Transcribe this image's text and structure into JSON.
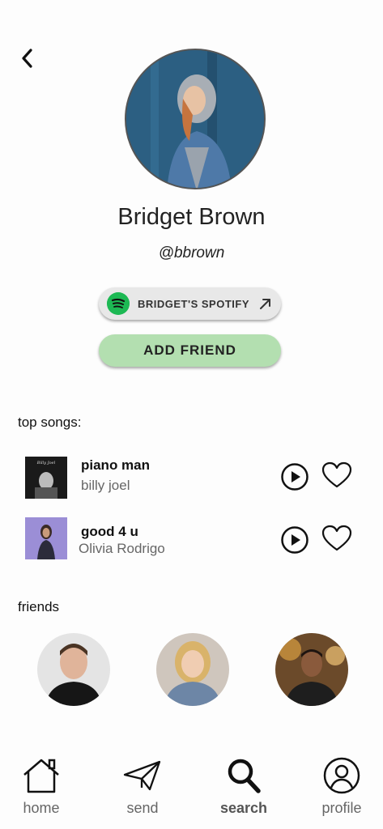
{
  "profile": {
    "name": "Bridget Brown",
    "handle": "@bbrown",
    "spotify_label": "BRIDGET'S SPOTIFY",
    "add_friend_label": "ADD FRIEND"
  },
  "top_songs": {
    "title": "top songs:",
    "items": [
      {
        "title": "piano man",
        "artist": "billy joel"
      },
      {
        "title": "good 4 u",
        "artist": "Olivia Rodrigo"
      }
    ]
  },
  "friends": {
    "title": "friends"
  },
  "nav": {
    "items": [
      {
        "label": "home",
        "icon": "home-icon"
      },
      {
        "label": "send",
        "icon": "paper-plane-icon"
      },
      {
        "label": "search",
        "icon": "search-icon",
        "active": true
      },
      {
        "label": "profile",
        "icon": "user-icon"
      }
    ]
  },
  "colors": {
    "spotify_green": "#1db954",
    "add_friend_bg": "#b3dfb0",
    "spotify_button_bg": "#e8e8e8"
  }
}
